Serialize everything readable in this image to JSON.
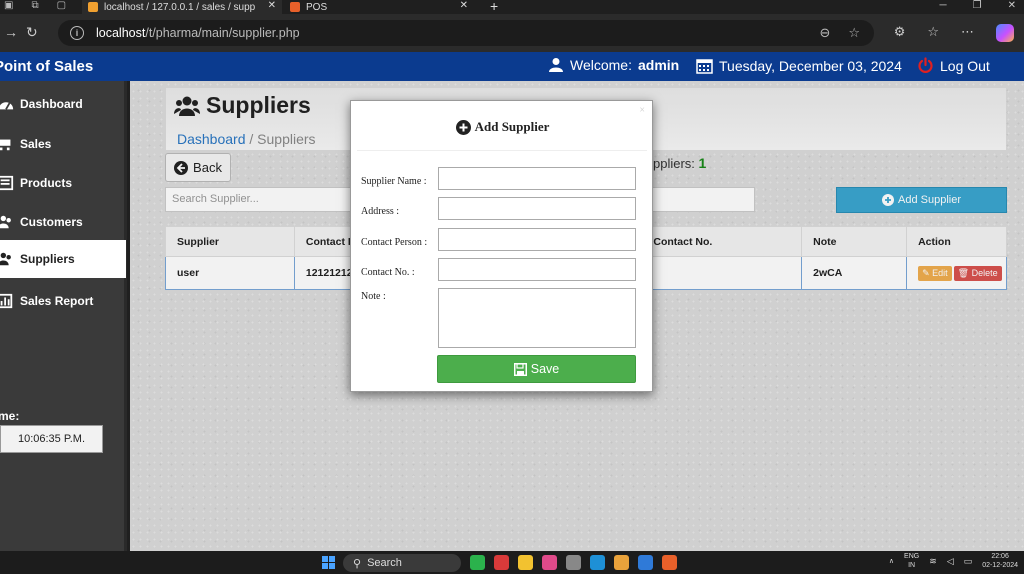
{
  "browser": {
    "tabs": [
      {
        "title": "localhost / 127.0.0.1 / sales / supp"
      },
      {
        "title": "POS"
      }
    ],
    "url_host": "localhost",
    "url_path": "/t/pharma/main/supplier.php"
  },
  "header": {
    "brand": "Point of Sales",
    "welcome_label": "Welcome:",
    "username": "admin",
    "date": "Tuesday, December 03, 2024",
    "logout": "Log Out"
  },
  "sidebar": {
    "items": [
      {
        "label": "Dashboard"
      },
      {
        "label": "Sales"
      },
      {
        "label": "Products"
      },
      {
        "label": "Customers"
      },
      {
        "label": "Suppliers"
      },
      {
        "label": "Sales Report"
      }
    ],
    "time_label": "me:",
    "time_value": "10:06:35 P.M."
  },
  "page": {
    "title": "Suppliers",
    "breadcrumb_home": "Dashboard",
    "breadcrumb_current": " / Suppliers",
    "back_label": "Back",
    "count_label": "ppliers:",
    "count_value": "1",
    "search_placeholder": "Search Supplier...",
    "add_label": "Add Supplier"
  },
  "table": {
    "headers": [
      "Supplier",
      "Contact Pe",
      "Contact No.",
      "Note",
      "Action"
    ],
    "rows": [
      {
        "supplier": "user",
        "contact_person": "12121212",
        "contact_no": "",
        "note": "2wCA",
        "edit": "Edit",
        "delete": "Delete"
      }
    ]
  },
  "modal": {
    "title": "Add Supplier",
    "close": "×",
    "fields": [
      "Supplier Name :",
      "Address :",
      "Contact Person :",
      "Contact No. :",
      "Note :"
    ],
    "save": "Save"
  },
  "taskbar": {
    "search": "Search",
    "lang_top": "ENG",
    "lang_bottom": "IN",
    "time": "22:06",
    "date": "02-12-2024"
  },
  "colors": {
    "header_bg": "#0b3b8f",
    "sidebar_bg": "#3a3a3a",
    "add_button": "#3aa6d0",
    "save_button": "#4cae4c",
    "logout_icon": "#e02020"
  }
}
